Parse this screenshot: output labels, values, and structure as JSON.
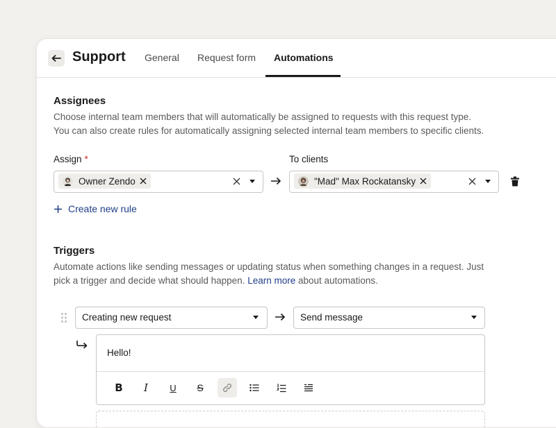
{
  "header": {
    "title": "Support",
    "tabs": [
      {
        "label": "General"
      },
      {
        "label": "Request form"
      },
      {
        "label": "Automations",
        "active": true
      }
    ]
  },
  "assignees": {
    "heading": "Assignees",
    "description_line1": "Choose internal team members that will automatically be assigned to requests with this request type.",
    "description_line2": "You can also create rules for automatically assigning selected internal team members to specific clients.",
    "assign_label": "Assign",
    "required_mark": "*",
    "assign_chip": "Owner Zendo",
    "clients_label": "To clients",
    "clients_chip": "\"Mad\" Max Rockatansky",
    "create_rule": "Create new rule"
  },
  "triggers": {
    "heading": "Triggers",
    "description_line1": "Automate actions like sending messages or updating status when something changes in a request. Just",
    "description_line2_before": "pick a trigger and decide what should happen. ",
    "learn_more": "Learn more",
    "description_line2_after": " about automations.",
    "trigger_select": "Creating new request",
    "action_select": "Send message",
    "message": "Hello!",
    "toolbar": {
      "bold": "B",
      "italic": "I",
      "underline": "U",
      "strike": "S"
    }
  },
  "colors": {
    "background": "#f3f1ee",
    "link": "#1e3f85",
    "required": "#d02a2a",
    "chip": "#efedea"
  }
}
